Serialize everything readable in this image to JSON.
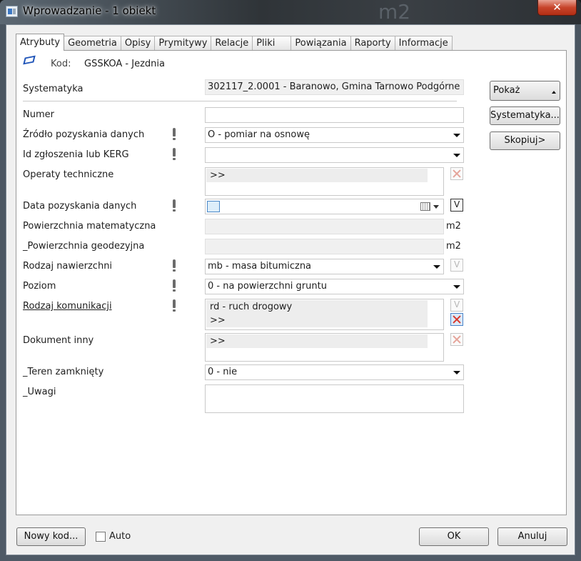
{
  "window": {
    "title": "Wprowadzanie - 1 obiekt",
    "close_label": "✕",
    "background_text": "m2"
  },
  "tabs": [
    "Atrybuty",
    "Geometria",
    "Opisy",
    "Prymitywy",
    "Relacje",
    "Pliki",
    "Powiązania",
    "Raporty",
    "Informacje"
  ],
  "header": {
    "kod_label": "Kod:",
    "kod_value": "GSSKOA - Jezdnia",
    "systematyka_label": "Systematyka",
    "systematyka_value": "302117_2.0001 - Baranowo, Gmina Tarnowo Podgórne"
  },
  "fields": {
    "numer": {
      "label": "Numer",
      "value": ""
    },
    "zrodlo": {
      "label": "Źródło pozyskania danych",
      "value": "O - pomiar na osnowę"
    },
    "id_zgloszenia": {
      "label": "Id zgłoszenia lub KERG",
      "value": ""
    },
    "operaty": {
      "label": "Operaty techniczne",
      "rows": [
        ">>"
      ]
    },
    "data": {
      "label": "Data pozyskania danych",
      "value": ""
    },
    "pow_mat": {
      "label": "Powierzchnia matematyczna",
      "value": "",
      "unit": "m2"
    },
    "pow_geo": {
      "label": "_Powierzchnia geodezyjna",
      "value": "",
      "unit": "m2"
    },
    "rodzaj_naw": {
      "label": "Rodzaj nawierzchni",
      "value": "mb - masa bitumiczna"
    },
    "poziom": {
      "label": "Poziom",
      "value": "0 - na powierzchni gruntu"
    },
    "rodzaj_kom": {
      "label": "Rodzaj komunikacji",
      "rows": [
        "rd - ruch drogowy",
        ">>"
      ]
    },
    "dokument": {
      "label": "Dokument inny",
      "rows": [
        ">>"
      ]
    },
    "teren": {
      "label": "_Teren zamknięty",
      "value": "0 - nie"
    },
    "uwagi": {
      "label": "_Uwagi",
      "value": ""
    }
  },
  "side_buttons": {
    "pokaz": "Pokaż",
    "systematyka": "Systematyka...",
    "skopiuj": "Skopiuj>"
  },
  "footer": {
    "nowy_kod": "Nowy kod...",
    "auto": "Auto",
    "ok": "OK",
    "anuluj": "Anuluj"
  }
}
